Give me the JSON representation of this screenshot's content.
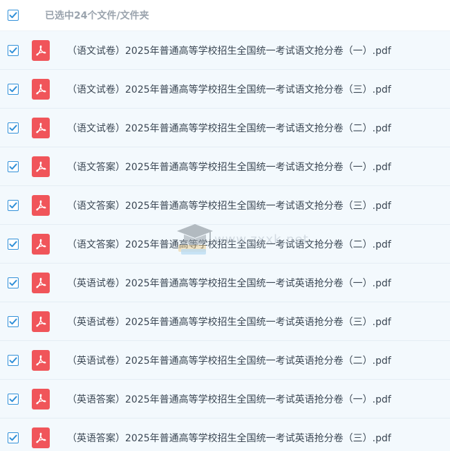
{
  "header": {
    "selected_label": "已选中24个文件/文件夹",
    "checked": true
  },
  "files": [
    {
      "name": "（语文试卷）2025年普通高等学校招生全国统一考试语文抢分卷（一）.pdf",
      "icon": "pdf-icon",
      "checked": true
    },
    {
      "name": "（语文试卷）2025年普通高等学校招生全国统一考试语文抢分卷（三）.pdf",
      "icon": "pdf-icon",
      "checked": true
    },
    {
      "name": "（语文试卷）2025年普通高等学校招生全国统一考试语文抢分卷（二）.pdf",
      "icon": "pdf-icon",
      "checked": true
    },
    {
      "name": "（语文答案）2025年普通高等学校招生全国统一考试语文抢分卷（一）.pdf",
      "icon": "pdf-icon",
      "checked": true
    },
    {
      "name": "（语文答案）2025年普通高等学校招生全国统一考试语文抢分卷（三）.pdf",
      "icon": "pdf-icon",
      "checked": true
    },
    {
      "name": "（语文答案）2025年普通高等学校招生全国统一考试语文抢分卷（二）.pdf",
      "icon": "pdf-icon",
      "checked": true
    },
    {
      "name": "（英语试卷）2025年普通高等学校招生全国统一考试英语抢分卷（一）.pdf",
      "icon": "pdf-icon",
      "checked": true
    },
    {
      "name": "（英语试卷）2025年普通高等学校招生全国统一考试英语抢分卷（三）.pdf",
      "icon": "pdf-icon",
      "checked": true
    },
    {
      "name": "（英语试卷）2025年普通高等学校招生全国统一考试英语抢分卷（二）.pdf",
      "icon": "pdf-icon",
      "checked": true
    },
    {
      "name": "（英语答案）2025年普通高等学校招生全国统一考试英语抢分卷（一）.pdf",
      "icon": "pdf-icon",
      "checked": true
    },
    {
      "name": "（英语答案）2025年普通高等学校招生全国统一考试英语抢分卷（三）.pdf",
      "icon": "pdf-icon",
      "checked": true
    }
  ],
  "watermark": {
    "text": "www.zxxk.net",
    "icon": "graduation-cap-icon"
  },
  "colors": {
    "accent": "#2f8fd8",
    "pdf_red": "#f0555a",
    "row_bg": "#f3f9fd"
  }
}
